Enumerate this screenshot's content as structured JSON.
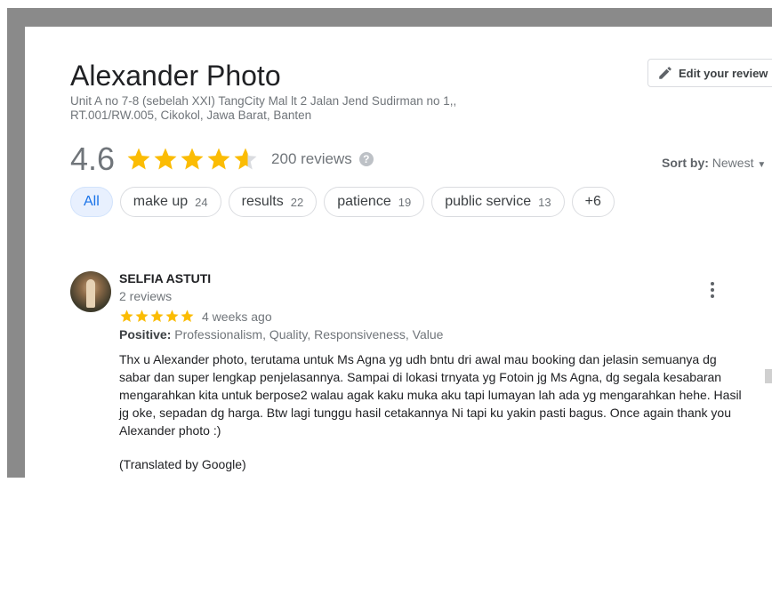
{
  "place": {
    "name": "Alexander Photo",
    "address": "Unit A no 7-8 (sebelah XXI) TangCity Mal lt 2 Jalan Jend Sudirman no 1,, RT.001/RW.005, Cikokol, Jawa Barat, Banten"
  },
  "edit_review_label": "Edit your review",
  "rating": {
    "value": "4.6",
    "stars": 4.6,
    "reviews_label": "200 reviews",
    "help_icon": "?"
  },
  "sort": {
    "label": "Sort by:",
    "value": "Newest"
  },
  "chips": [
    {
      "label": "All",
      "count": ""
    },
    {
      "label": "make up",
      "count": "24"
    },
    {
      "label": "results",
      "count": "22"
    },
    {
      "label": "patience",
      "count": "19"
    },
    {
      "label": "public service",
      "count": "13"
    },
    {
      "label": "+6",
      "count": ""
    }
  ],
  "review": {
    "author": "SELFIA ASTUTI",
    "author_reviews": "2 reviews",
    "stars": 5,
    "time": "4 weeks ago",
    "positive_label": "Positive:",
    "positive_values": "Professionalism, Quality, Responsiveness, Value",
    "text": "Thx u Alexander photo, terutama untuk Ms Agna yg udh bntu dri awal mau booking dan jelasin semuanya dg sabar dan super lengkap penjelasannya. Sampai di lokasi trnyata yg Fotoin jg Ms Agna, dg segala kesabaran mengarahkan kita untuk berpose2 walau agak kaku muka aku tapi lumayan lah ada yg mengarahkan hehe. Hasil jg oke, sepadan dg harga. Btw lagi tunggu hasil cetakannya Ni tapi ku yakin pasti bagus. Once again thank you Alexander photo :)",
    "translated": "(Translated by Google)"
  },
  "colors": {
    "star": "#fbbc04",
    "star_empty": "#dadce0",
    "accent": "#1a73e8"
  },
  "icons": {
    "edit": "pencil-icon",
    "help": "help-icon",
    "sort": "dropdown-arrow-icon",
    "more": "more-vert-icon"
  }
}
